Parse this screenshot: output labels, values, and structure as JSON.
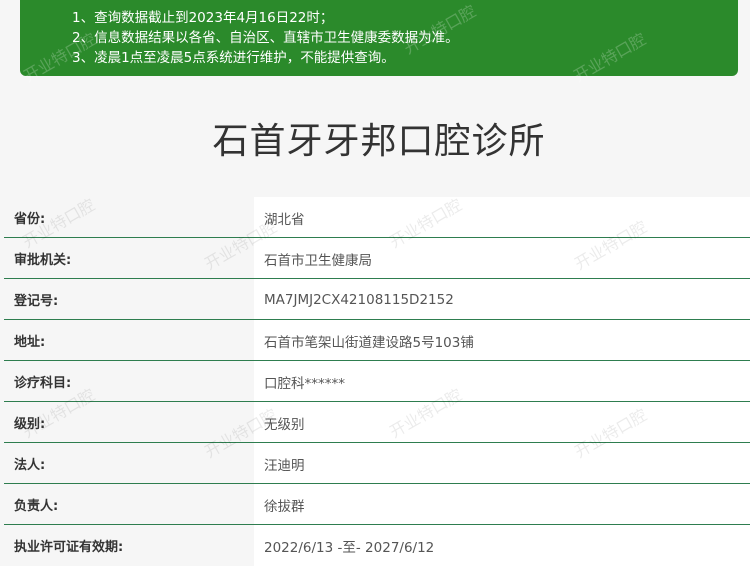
{
  "notice": {
    "lines": [
      "1、查询数据截止到2023年4月16日22时；",
      "2、信息数据结果以各省、自治区、直辖市卫生健康委数据为准。",
      "3、凌晨1点至凌晨5点系统进行维护，不能提供查询。"
    ],
    "bg_color": "#2b8a2b"
  },
  "title": "石首牙牙邦口腔诊所",
  "watermark": "开业特口腔",
  "rows": [
    {
      "label": "省份:",
      "value": "湖北省"
    },
    {
      "label": "审批机关:",
      "value": "石首市卫生健康局"
    },
    {
      "label": "登记号:",
      "value": "MA7JMJ2CX42108115D2152"
    },
    {
      "label": "地址:",
      "value": "石首市笔架山街道建设路5号103铺"
    },
    {
      "label": "诊疗科目:",
      "value": "口腔科******"
    },
    {
      "label": "级别:",
      "value": "无级别"
    },
    {
      "label": "法人:",
      "value": "汪迪明"
    },
    {
      "label": "负责人:",
      "value": "徐拔群"
    },
    {
      "label": "执业许可证有效期:",
      "value": "2022/6/13 -至- 2027/6/12"
    }
  ]
}
